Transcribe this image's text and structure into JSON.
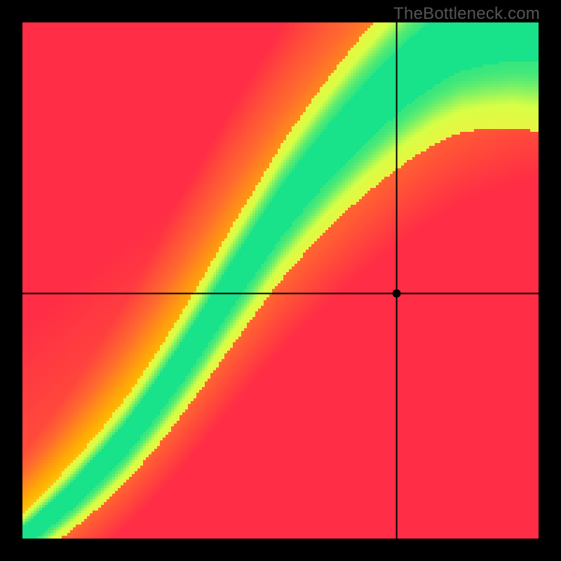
{
  "attribution": "TheBottleneck.com",
  "chart_data": {
    "type": "heatmap",
    "title": "",
    "xlabel": "",
    "ylabel": "",
    "x_range": [
      0,
      1
    ],
    "y_range": [
      0,
      1
    ],
    "crosshair": {
      "x": 0.725,
      "y": 0.475
    },
    "marker": {
      "x": 0.725,
      "y": 0.475
    },
    "ridge": {
      "description": "green ideal-match curve; points are (x_fraction, y_fraction)",
      "points": [
        [
          0.0,
          0.0
        ],
        [
          0.05,
          0.04
        ],
        [
          0.1,
          0.085
        ],
        [
          0.15,
          0.135
        ],
        [
          0.2,
          0.19
        ],
        [
          0.25,
          0.255
        ],
        [
          0.3,
          0.325
        ],
        [
          0.35,
          0.4
        ],
        [
          0.4,
          0.48
        ],
        [
          0.45,
          0.555
        ],
        [
          0.5,
          0.63
        ],
        [
          0.55,
          0.695
        ],
        [
          0.6,
          0.755
        ],
        [
          0.65,
          0.81
        ],
        [
          0.7,
          0.86
        ],
        [
          0.75,
          0.905
        ],
        [
          0.8,
          0.945
        ],
        [
          0.85,
          0.975
        ],
        [
          0.9,
          0.99
        ],
        [
          0.95,
          1.0
        ],
        [
          1.0,
          1.0
        ]
      ]
    },
    "ridge_width_base": 0.018,
    "ridge_width_scale": 0.06,
    "colorscale": {
      "description": "value 0..1 mapped via stops",
      "stops": [
        {
          "v": 0.0,
          "c": "#ff2d46"
        },
        {
          "v": 0.3,
          "c": "#ff6a2f"
        },
        {
          "v": 0.55,
          "c": "#ffb400"
        },
        {
          "v": 0.75,
          "c": "#ffe93d"
        },
        {
          "v": 0.88,
          "c": "#d8ff46"
        },
        {
          "v": 1.0,
          "c": "#18e28a"
        }
      ]
    },
    "resolution": 184
  }
}
